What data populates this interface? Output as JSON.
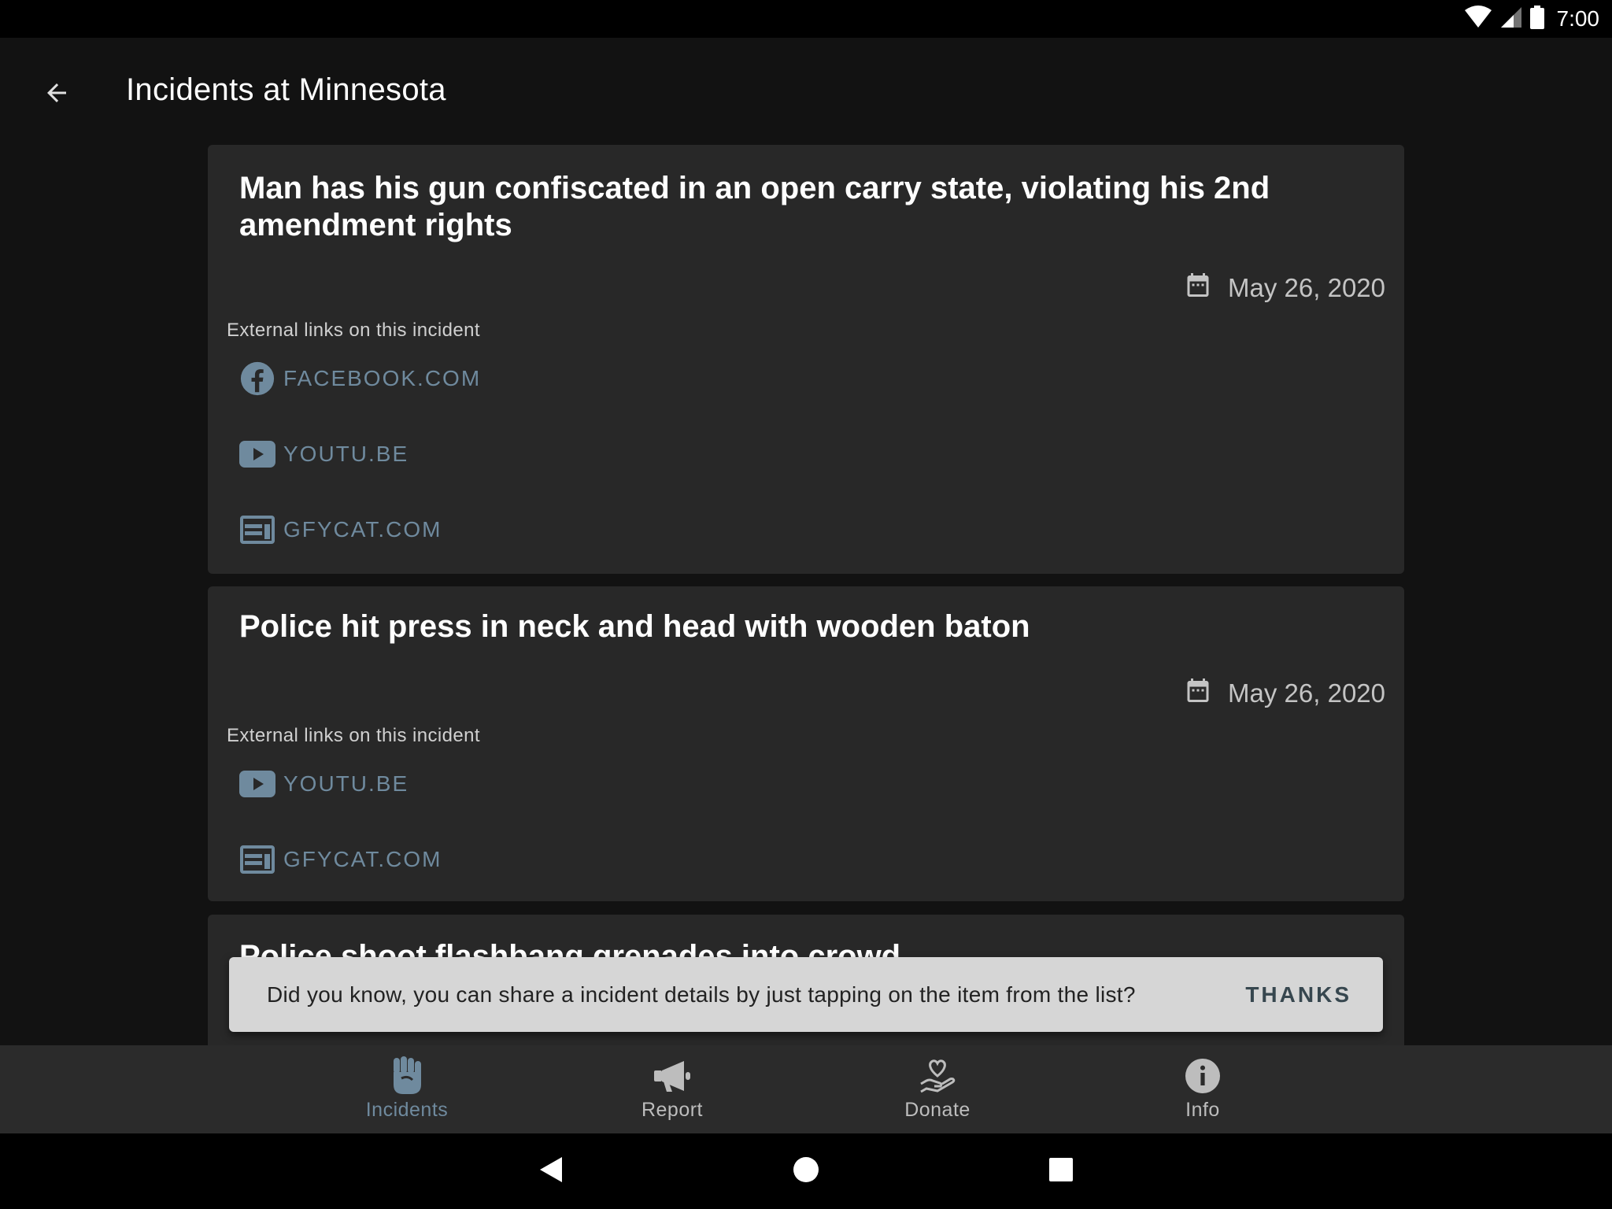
{
  "status_bar": {
    "time": "7:00"
  },
  "app_bar": {
    "title": "Incidents at Minnesota"
  },
  "incidents": [
    {
      "title": "Man has his gun confiscated in an open carry state, violating his 2nd amendment rights",
      "date": "May 26, 2020",
      "links_label": "External links on this incident",
      "links": [
        {
          "label": "FACEBOOK.COM",
          "icon": "facebook-icon"
        },
        {
          "label": "YOUTU.BE",
          "icon": "youtube-icon"
        },
        {
          "label": "GFYCAT.COM",
          "icon": "web-icon"
        }
      ]
    },
    {
      "title": "Police hit press in neck and head with wooden baton",
      "date": "May 26, 2020",
      "links_label": "External links on this incident",
      "links": [
        {
          "label": "YOUTU.BE",
          "icon": "youtube-icon"
        },
        {
          "label": "GFYCAT.COM",
          "icon": "web-icon"
        }
      ]
    },
    {
      "title": "Police shoot flashbang grenades into crowd"
    }
  ],
  "snackbar": {
    "message": "Did you know, you can share a incident details by just tapping on the item from the list?",
    "action": "THANKS"
  },
  "bottom_nav": {
    "items": [
      {
        "label": "Incidents",
        "icon": "fist-icon",
        "active": true
      },
      {
        "label": "Report",
        "icon": "megaphone-icon",
        "active": false
      },
      {
        "label": "Donate",
        "icon": "heart-hand-icon",
        "active": false
      },
      {
        "label": "Info",
        "icon": "info-icon",
        "active": false
      }
    ]
  },
  "colors": {
    "background": "#121212",
    "card": "#282828",
    "accent": "#6f8a9e",
    "snackbar": "#d6d6d6",
    "bottom_nav": "#2b2b2b"
  }
}
